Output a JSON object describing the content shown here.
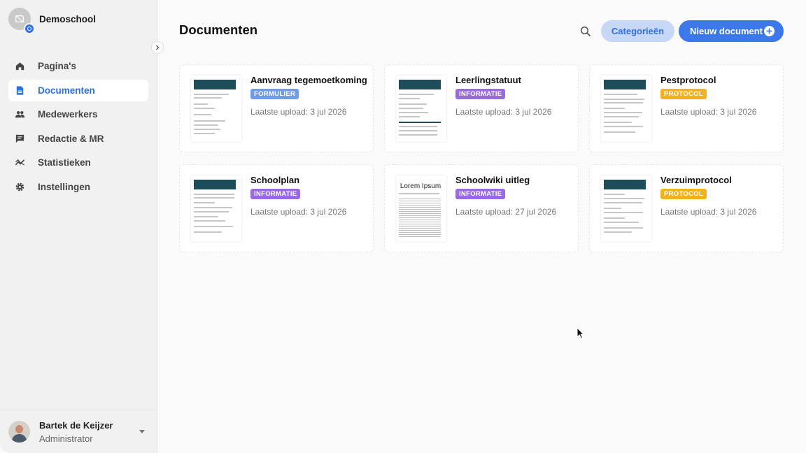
{
  "sidebar": {
    "school_name": "Demoschool",
    "items": [
      {
        "label": "Pagina's",
        "icon": "home-icon",
        "active": false
      },
      {
        "label": "Documenten",
        "icon": "document-icon",
        "active": true
      },
      {
        "label": "Medewerkers",
        "icon": "people-icon",
        "active": false
      },
      {
        "label": "Redactie & MR",
        "icon": "chat-icon",
        "active": false
      },
      {
        "label": "Statistieken",
        "icon": "trend-icon",
        "active": false
      },
      {
        "label": "Instellingen",
        "icon": "gear-icon",
        "active": false
      }
    ],
    "user": {
      "name": "Bartek de Keijzer",
      "role": "Administrator"
    }
  },
  "header": {
    "title": "Documenten",
    "categories_label": "Categorieën",
    "new_document_label": "Nieuw document"
  },
  "colors": {
    "accent": "#3d78ea",
    "formulier": "#6f9bea",
    "informatie": "#9a6be0",
    "protocol": "#f2b21c"
  },
  "documents": [
    {
      "title": "Aanvraag tegemoetkoming",
      "category": "FORMULIER",
      "category_color": "#6f9bea",
      "meta": "Laatste upload: 3 jul 2026",
      "thumb": "form"
    },
    {
      "title": "Leerlingstatuut",
      "category": "INFORMATIE",
      "category_color": "#9a6be0",
      "meta": "Laatste upload: 3 jul 2026",
      "thumb": "doc"
    },
    {
      "title": "Pestprotocol",
      "category": "PROTOCOL",
      "category_color": "#f2b21c",
      "meta": "Laatste upload: 3 jul 2026",
      "thumb": "doc"
    },
    {
      "title": "Schoolplan",
      "category": "INFORMATIE",
      "category_color": "#9a6be0",
      "meta": "Laatste upload: 3 jul 2026",
      "thumb": "doc"
    },
    {
      "title": "Schoolwiki uitleg",
      "category": "INFORMATIE",
      "category_color": "#9a6be0",
      "meta": "Laatste upload: 27 jul 2026",
      "thumb": "lorem",
      "thumb_text": "Lorem Ipsum"
    },
    {
      "title": "Verzuimprotocol",
      "category": "PROTOCOL",
      "category_color": "#f2b21c",
      "meta": "Laatste upload: 3 jul 2026",
      "thumb": "doc"
    }
  ]
}
